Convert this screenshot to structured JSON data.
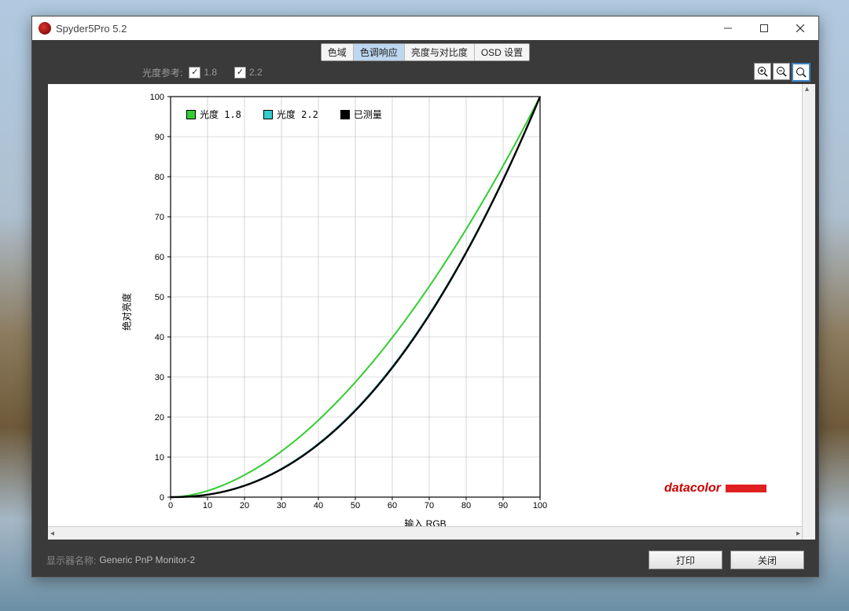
{
  "window": {
    "title": "Spyder5Pro 5.2"
  },
  "tabs": [
    {
      "label": "色域",
      "active": false
    },
    {
      "label": "色调响应",
      "active": true
    },
    {
      "label": "亮度与对比度",
      "active": false
    },
    {
      "label": "OSD 设置",
      "active": false
    }
  ],
  "options": {
    "label": "光度参考:",
    "ref18": {
      "checked": true,
      "value": "1.8"
    },
    "ref22": {
      "checked": true,
      "value": "2.2"
    }
  },
  "legend": {
    "s1": "光度 1.8",
    "s2": "光度 2.2",
    "s3": "已测量",
    "c1": "#33cc33",
    "c2": "#33cccc",
    "c3": "#000000"
  },
  "axis": {
    "x": "输入 RGB",
    "y": "绝对亮度"
  },
  "brand": "datacolor",
  "footer": {
    "display_label": "显示器名称:",
    "display_value": "Generic PnP Monitor-2",
    "print": "打印",
    "close": "关闭"
  },
  "chart_data": {
    "type": "line",
    "title": "",
    "xlabel": "输入 RGB",
    "ylabel": "绝对亮度",
    "xlim": [
      0,
      100
    ],
    "ylim": [
      0,
      100
    ],
    "x": [
      0,
      10,
      20,
      30,
      40,
      50,
      60,
      70,
      80,
      90,
      100
    ],
    "series": [
      {
        "name": "光度 1.8",
        "color": "#33cc33",
        "values": [
          0.0,
          1.6,
          5.5,
          11.4,
          19.2,
          28.7,
          39.9,
          52.6,
          66.9,
          82.7,
          100.0
        ]
      },
      {
        "name": "光度 2.2",
        "color": "#33cccc",
        "values": [
          0.0,
          0.6,
          2.9,
          7.1,
          13.3,
          21.8,
          32.5,
          45.7,
          61.2,
          79.3,
          100.0
        ]
      },
      {
        "name": "已测量",
        "color": "#000000",
        "values": [
          0.0,
          0.6,
          2.9,
          7.1,
          13.2,
          21.6,
          32.3,
          45.4,
          61.0,
          79.1,
          100.0
        ]
      }
    ]
  }
}
